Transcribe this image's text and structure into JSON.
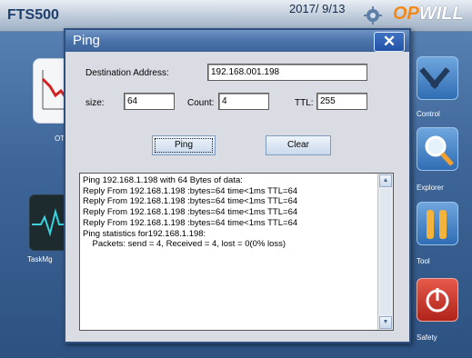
{
  "header": {
    "app_title": "FTS500",
    "date": "2017/ 9/13",
    "logo_accent": "OP",
    "logo_rest": "WILL"
  },
  "desktop": {
    "left_tiles": [
      {
        "label": "OT",
        "icon": "chart-icon"
      },
      {
        "label": "TaskMg",
        "icon": "heartbeat-icon"
      }
    ],
    "right_tiles": [
      {
        "label": "Control",
        "icon": "tools-icon"
      },
      {
        "label": "Explorer",
        "icon": "magnifier-icon"
      },
      {
        "label": "Tool",
        "icon": "wrench-icon"
      },
      {
        "label": "Safety",
        "icon": "power-icon"
      }
    ]
  },
  "dialog": {
    "title": "Ping",
    "close_label": "✕",
    "destination_label": "Destination Address:",
    "destination_value": "192.168.001.198",
    "size_label": "size:",
    "size_value": "64",
    "count_label": "Count:",
    "count_value": "4",
    "ttl_label": "TTL:",
    "ttl_value": "255",
    "ping_button": "Ping",
    "clear_button": "Clear",
    "output_lines": [
      "Ping 192.168.1.198 with 64 Bytes of data:",
      "Reply From 192.168.1.198 :bytes=64 time<1ms TTL=64",
      "Reply From 192.168.1.198 :bytes=64 time<1ms TTL=64",
      "Reply From 192.168.1.198 :bytes=64 time<1ms TTL=64",
      "Reply From 192.168.1.198 :bytes=64 time<1ms TTL=64",
      "Ping statistics for192.168.1.198:",
      "    Packets: send = 4, Received = 4, lost = 0(0% loss)"
    ]
  },
  "colors": {
    "title_bar": "#4b74ab",
    "close_button": "#2352a6",
    "logo_accent": "#f08a1b"
  }
}
